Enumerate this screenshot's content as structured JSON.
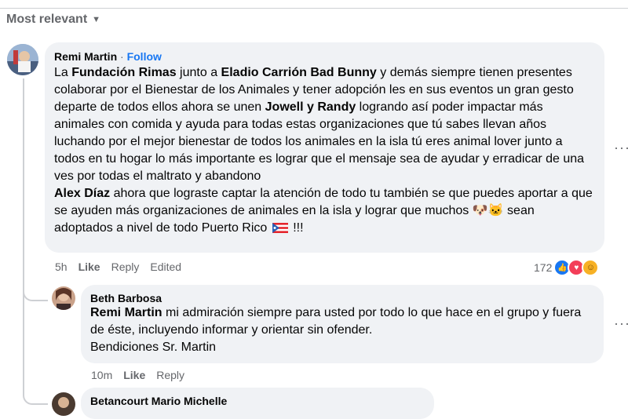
{
  "filter": {
    "label": "Most relevant"
  },
  "comments": [
    {
      "author": "Remi Martin",
      "follow_sep": " · ",
      "follow": "Follow",
      "parts": {
        "p1": "La ",
        "b1": "Fundación Rimas",
        "p2": " junto a ",
        "b2": "Eladio Carrión Bad Bunny",
        "p3": " y demás siempre tienen presentes colaborar por el Bienestar de los Animales y tener adopción les en sus eventos un gran gesto departe de todos ellos ahora se unen ",
        "b3": "Jowell y Randy",
        "p4": " logrando así poder impactar más animales con comida y ayuda para todas estas organizaciones que tú sabes llevan años luchando por el mejor bienestar de todos los animales en la isla tú eres animal lover junto a todos en tu hogar lo más importante es lograr que el mensaje sea de ayudar y erradicar de una ves por todas el maltrato y abandono",
        "b4": "Alex Díaz",
        "p5": " ahora que lograste captar la atención de todo tu también se que puedes aportar a que se ayuden más organizaciones de animales en la isla y lograr que muchos ",
        "emoji": "🐶🐱",
        "p6": " sean adoptados a nivel de todo Puerto Rico ",
        "p7": " !!!"
      },
      "time": "5h",
      "like": "Like",
      "reply": "Reply",
      "edited": "Edited",
      "reaction_count": "172",
      "reaction_icons": [
        "like-icon",
        "love-icon",
        "care-icon"
      ]
    },
    {
      "author": "Beth Barbosa",
      "mention": "Remi Martin",
      "text1": " mi admiración siempre para usted por todo lo que hace en el grupo y fuera de éste, incluyendo informar y orientar sin ofender.",
      "text2": "Bendiciones Sr. Martin",
      "time": "10m",
      "like": "Like",
      "reply": "Reply"
    },
    {
      "author": "Betancourt Mario Michelle"
    }
  ],
  "more_options": "···",
  "colors": {
    "accent": "#1877f2",
    "bubble": "#f0f2f5",
    "muted": "#65676b"
  }
}
